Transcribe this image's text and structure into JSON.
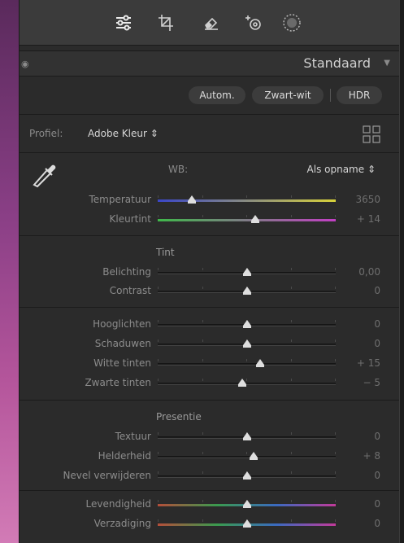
{
  "toolbar": {
    "tools": [
      "sliders-icon",
      "crop-icon",
      "eraser-icon",
      "heal-icon",
      "mask-icon"
    ]
  },
  "preset": {
    "name": "Standaard",
    "arrow": "▼"
  },
  "buttons": {
    "auto": "Autom.",
    "bw": "Zwart-wit",
    "hdr": "HDR"
  },
  "profile": {
    "label": "Profiel:",
    "value": "Adobe Kleur ⇕"
  },
  "wb": {
    "label": "WB:",
    "value": "Als opname ⇕"
  },
  "sections": {
    "tint": "Tint",
    "presence": "Presentie"
  },
  "sliders": {
    "temp": {
      "label": "Temperatuur",
      "value": "3650",
      "pos": 0.19
    },
    "tint": {
      "label": "Kleurtint",
      "value": "+ 14",
      "pos": 0.55
    },
    "exposure": {
      "label": "Belichting",
      "value": "0,00",
      "pos": 0.5
    },
    "contrast": {
      "label": "Contrast",
      "value": "0",
      "pos": 0.5
    },
    "highlights": {
      "label": "Hooglichten",
      "value": "0",
      "pos": 0.5
    },
    "shadows": {
      "label": "Schaduwen",
      "value": "0",
      "pos": 0.5
    },
    "whites": {
      "label": "Witte tinten",
      "value": "+ 15",
      "pos": 0.575
    },
    "blacks": {
      "label": "Zwarte tinten",
      "value": "− 5",
      "pos": 0.475
    },
    "texture": {
      "label": "Textuur",
      "value": "0",
      "pos": 0.5
    },
    "clarity": {
      "label": "Helderheid",
      "value": "+ 8",
      "pos": 0.54
    },
    "dehaze": {
      "label": "Nevel verwijderen",
      "value": "0",
      "pos": 0.5
    },
    "vibrance": {
      "label": "Levendigheid",
      "value": "0",
      "pos": 0.5
    },
    "saturation": {
      "label": "Verzadiging",
      "value": "0",
      "pos": 0.5
    }
  },
  "colors": {
    "accent": "#dedede",
    "temp_gradient": [
      "#3a46c8",
      "#d8d23a"
    ],
    "tint_gradient": [
      "#3fb84a",
      "#c23fc4"
    ],
    "vibrance_gradient": [
      "#b44e3a",
      "#3a9a4e",
      "#3a6ac0",
      "#c23a9a"
    ]
  }
}
